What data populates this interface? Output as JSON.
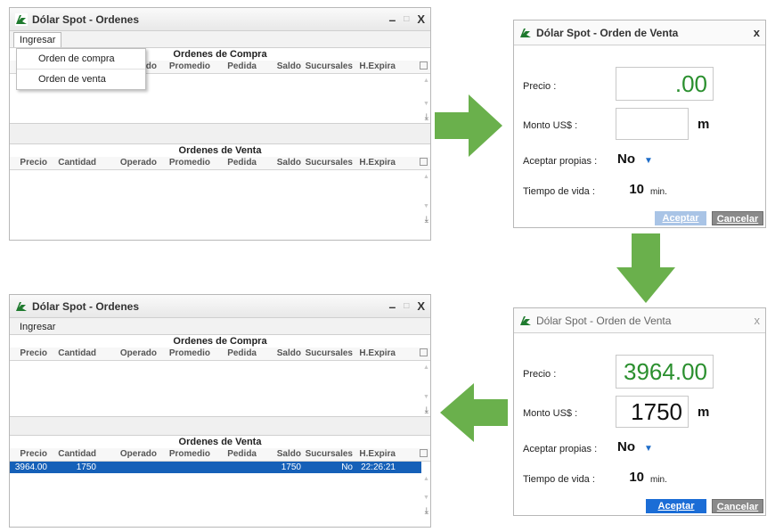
{
  "orders_window": {
    "title": "Dólar Spot - Ordenes",
    "menu_label": "Ingresar",
    "buy_section_title": "Ordenes de Compra",
    "sell_section_title": "Ordenes de Venta",
    "columns": [
      "Precio",
      "Cantidad",
      "Operado",
      "Promedio",
      "Pedida",
      "Saldo",
      "Sucursales",
      "H.Expira"
    ],
    "dropdown_items": [
      "Orden de compra",
      "Orden de venta"
    ],
    "partial_column": "ado"
  },
  "order_dialog": {
    "title": "Dólar Spot - Orden de Venta",
    "price_label": "Precio :",
    "amount_label": "Monto US$ :",
    "accept_own_label": "Aceptar propias :",
    "lifetime_label": "Tiempo de vida :",
    "unit_m": "m",
    "accept_own_value": "No",
    "lifetime_value": "10",
    "lifetime_unit": "min.",
    "accept_button": "Aceptar",
    "cancel_button": "Cancelar",
    "empty": {
      "price_value": ".00",
      "amount_value": ""
    },
    "filled": {
      "price_value": "3964.00",
      "amount_value": "1750"
    }
  },
  "result_row": {
    "precio": "3964.00",
    "cantidad": "1750",
    "saldo": "1750",
    "sucursales": "No",
    "h_expira": "22:26:21"
  },
  "colors": {
    "selection": "#1560b8",
    "arrow_green": "#6ab04c",
    "accept_blue": "#1b6dd6",
    "value_green": "#2a8f2e"
  },
  "icons": [
    "app-logo-icon",
    "minimize-icon",
    "maximize-icon",
    "close-icon",
    "dropdown-caret-icon",
    "export-icon",
    "column-chooser-icon",
    "arrow-right-icon",
    "arrow-down-icon",
    "arrow-left-icon"
  ]
}
